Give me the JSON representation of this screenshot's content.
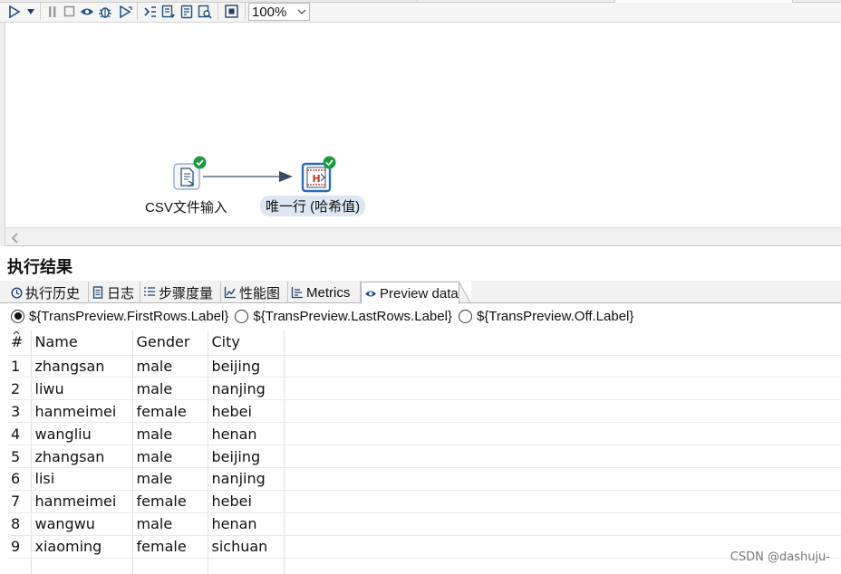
{
  "toolbar": {
    "zoom_value": "100%",
    "icons": [
      "run-icon",
      "run-options-icon",
      "pause-icon",
      "stop-icon",
      "preview-icon",
      "debug-icon",
      "replay-icon",
      "verify-icon",
      "impact-icon",
      "sql-icon",
      "explore-db-icon",
      "grid-icon"
    ]
  },
  "canvas": {
    "steps": [
      {
        "label": "CSV文件输入",
        "status": "ok"
      },
      {
        "label": "唯一行 (哈希值)",
        "status": "ok"
      }
    ]
  },
  "results": {
    "title": "执行结果",
    "tabs": [
      {
        "label": "执行历史",
        "icon": "history-icon"
      },
      {
        "label": "日志",
        "icon": "log-icon"
      },
      {
        "label": "步骤度量",
        "icon": "step-metrics-icon"
      },
      {
        "label": "性能图",
        "icon": "performance-chart-icon"
      },
      {
        "label": "Metrics",
        "icon": "metrics-icon"
      },
      {
        "label": "Preview data",
        "icon": "eye-icon",
        "active": true
      }
    ],
    "radios": [
      {
        "label": "${TransPreview.FirstRows.Label}",
        "selected": true
      },
      {
        "label": "${TransPreview.LastRows.Label}",
        "selected": false
      },
      {
        "label": "${TransPreview.Off.Label}",
        "selected": false
      }
    ],
    "table": {
      "columns": [
        "#",
        "Name",
        "Gender",
        "City"
      ],
      "rows": [
        [
          "1",
          "zhangsan",
          "male",
          "beijing"
        ],
        [
          "2",
          "liwu",
          "male",
          "nanjing"
        ],
        [
          "3",
          "hanmeimei",
          "female",
          "hebei"
        ],
        [
          "4",
          "wangliu",
          "male",
          "henan"
        ],
        [
          "5",
          "zhangsan",
          "male",
          "beijing"
        ],
        [
          "6",
          "lisi",
          "male",
          "nanjing"
        ],
        [
          "7",
          "hanmeimei",
          "female",
          "hebei"
        ],
        [
          "8",
          "wangwu",
          "male",
          "henan"
        ],
        [
          "9",
          "xiaoming",
          "female",
          "sichuan"
        ]
      ]
    }
  },
  "watermark": "CSDN @dashuju-",
  "colors": {
    "accent": "#2a6db5",
    "ok_badge": "#1a9b3c",
    "selection": "#dce7f3"
  }
}
